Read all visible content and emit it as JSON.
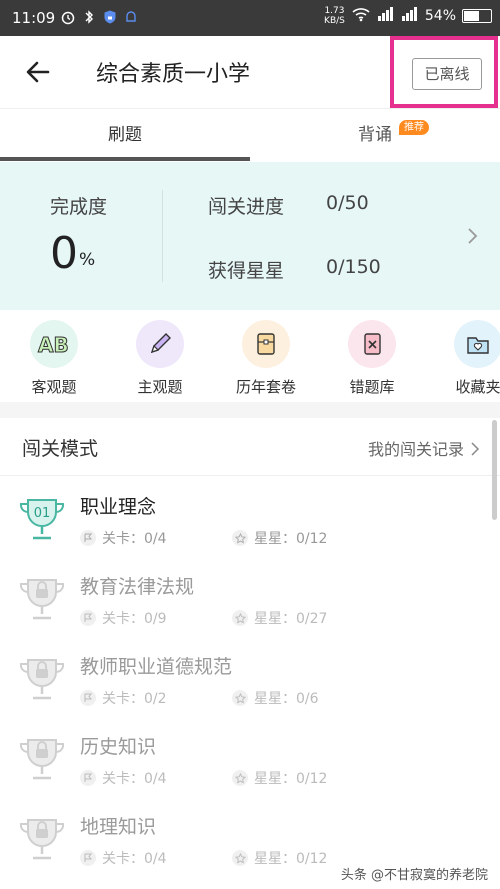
{
  "status_bar": {
    "time": "11:09",
    "speed_top": "1.73",
    "speed_unit": "KB/S",
    "battery_text": "54%",
    "battery_level": 0.54
  },
  "header": {
    "title": "综合素质一小学",
    "offline_label": "已离线",
    "highlight_color": "#e5308f"
  },
  "tabs": [
    {
      "label": "刷题",
      "active": true
    },
    {
      "label": "背诵",
      "badge": "推荐"
    }
  ],
  "progress": {
    "completion_label": "完成度",
    "completion_value": "0",
    "completion_unit": "%",
    "level_progress_label": "闯关进度",
    "level_progress_value": "0/50",
    "stars_label": "获得星星",
    "stars_value": "0/150"
  },
  "categories": [
    {
      "label": "客观题",
      "icon": "ab-icon"
    },
    {
      "label": "主观题",
      "icon": "pencil-icon"
    },
    {
      "label": "历年套卷",
      "icon": "folder-paper-icon"
    },
    {
      "label": "错题库",
      "icon": "wrong-book-icon"
    },
    {
      "label": "收藏夹",
      "icon": "favorites-icon"
    }
  ],
  "mode": {
    "title": "闯关模式",
    "record_link": "我的闯关记录",
    "levels": [
      {
        "name": "职业理念",
        "cup_label": "01",
        "stages": "关卡：0/4",
        "stars": "星星：0/12",
        "locked": false
      },
      {
        "name": "教育法律法规",
        "stages": "关卡：0/9",
        "stars": "星星：0/27",
        "locked": true
      },
      {
        "name": "教师职业道德规范",
        "stages": "关卡：0/2",
        "stars": "星星：0/6",
        "locked": true
      },
      {
        "name": "历史知识",
        "stages": "关卡：0/4",
        "stars": "星星：0/12",
        "locked": true
      },
      {
        "name": "地理知识",
        "stages": "关卡：0/4",
        "stars": "星星：0/12",
        "locked": true
      }
    ]
  },
  "watermark": "头条 @不甘寂寞的养老院"
}
